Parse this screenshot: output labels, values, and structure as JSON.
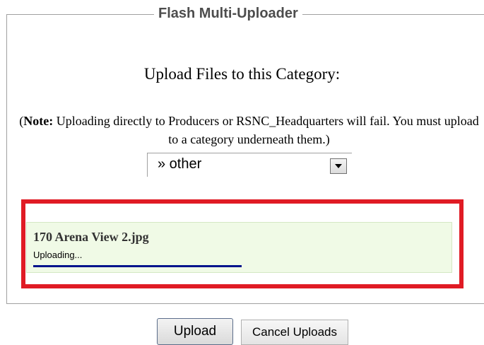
{
  "legend": "Flash Multi-Uploader",
  "heading": "Upload Files to this Category:",
  "note": {
    "open": "(",
    "bold": "Note:",
    "text": " Uploading directly to Producers or RSNC_Headquarters will fail. You must upload to a category underneath them.)"
  },
  "category_select": {
    "selected": "» other"
  },
  "upload_item": {
    "file_name": "170 Arena View 2.jpg",
    "status": "Uploading...",
    "progress": 0.49
  },
  "buttons": {
    "upload": "Upload",
    "cancel": "Cancel Uploads"
  },
  "colors": {
    "highlight_border": "#e01b24",
    "progress_panel": "#f0fae6",
    "progress_bar": "#00138c"
  }
}
